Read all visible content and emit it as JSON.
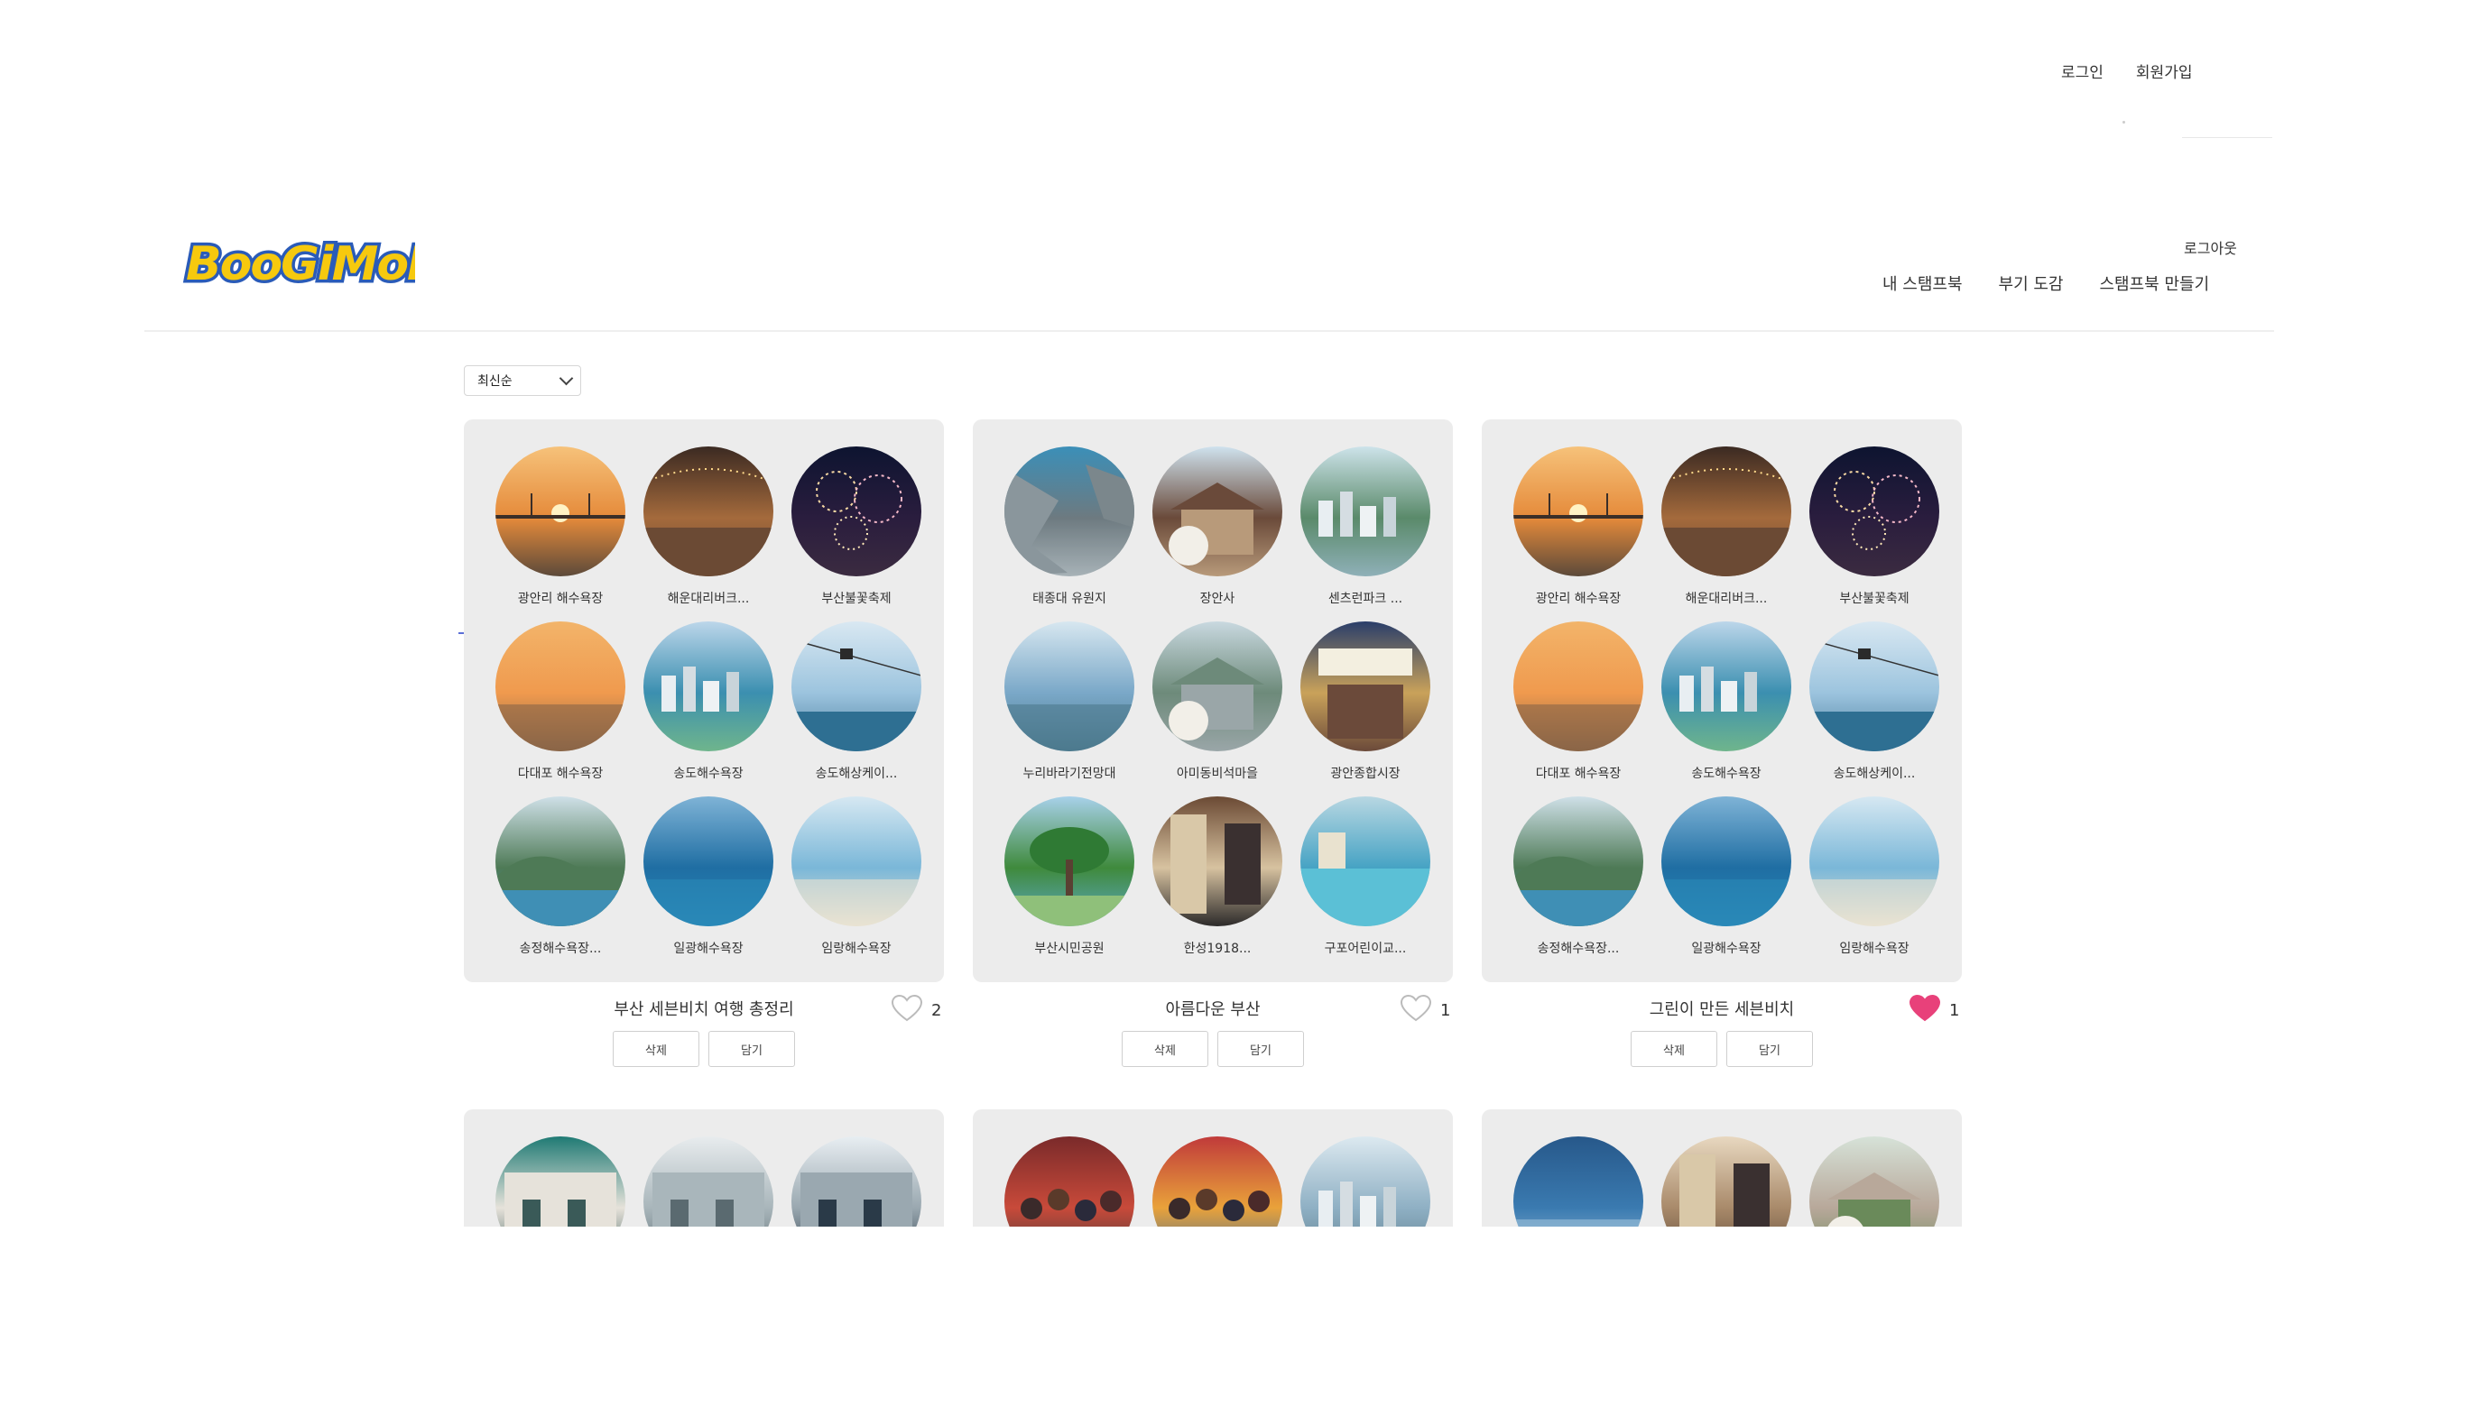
{
  "top_links": {
    "login": "로그인",
    "signup": "회원가입"
  },
  "header": {
    "logo_text": "BooGiMoN",
    "logout": "로그아웃",
    "nav": [
      "내 스탬프북",
      "부기 도감",
      "스탬프북 만들기"
    ]
  },
  "sort": {
    "selected": "최신순"
  },
  "colors": {
    "card_bg": "#ececec",
    "liked_heart": "#e8417a",
    "accent_line": "#5b6fd6"
  },
  "cards": [
    {
      "title": "부산 세븐비치 여행 총정리",
      "likes": "2",
      "liked": false,
      "delete_label": "삭제",
      "save_label": "담기",
      "items": [
        {
          "label": "광안리 해수욕장",
          "img": "sunset-bridge"
        },
        {
          "label": "해운대리버크...",
          "img": "evening-crowd"
        },
        {
          "label": "부산불꽃축제",
          "img": "fireworks"
        },
        {
          "label": "다대포 해수욕장",
          "img": "orange-sunset"
        },
        {
          "label": "송도해수욕장",
          "img": "bay-city"
        },
        {
          "label": "송도해상케이...",
          "img": "cable-car"
        },
        {
          "label": "송정해수욕장...",
          "img": "green-coast"
        },
        {
          "label": "일광해수욕장",
          "img": "blue-sea"
        },
        {
          "label": "임랑해수욕장",
          "img": "light-beach"
        }
      ]
    },
    {
      "title": "아름다운 부산",
      "likes": "1",
      "liked": false,
      "delete_label": "삭제",
      "save_label": "담기",
      "items": [
        {
          "label": "태종대 유원지",
          "img": "rocky-coast"
        },
        {
          "label": "장안사",
          "img": "temple"
        },
        {
          "label": "센츠런파크 ...",
          "img": "park-building"
        },
        {
          "label": "누리바라기전망대",
          "img": "observatory"
        },
        {
          "label": "아미동비석마을",
          "img": "village"
        },
        {
          "label": "광안종합시장",
          "img": "market"
        },
        {
          "label": "부산시민공원",
          "img": "tree-park"
        },
        {
          "label": "한성1918...",
          "img": "cafe-interior"
        },
        {
          "label": "구포어린이교...",
          "img": "water-park"
        }
      ]
    },
    {
      "title": "그린이 만든 세븐비치",
      "likes": "1",
      "liked": true,
      "delete_label": "삭제",
      "save_label": "담기",
      "items": [
        {
          "label": "광안리 해수욕장",
          "img": "sunset-bridge"
        },
        {
          "label": "해운대리버크...",
          "img": "evening-crowd"
        },
        {
          "label": "부산불꽃축제",
          "img": "fireworks"
        },
        {
          "label": "다대포 해수욕장",
          "img": "orange-sunset"
        },
        {
          "label": "송도해수욕장",
          "img": "bay-city"
        },
        {
          "label": "송도해상케이...",
          "img": "cable-car"
        },
        {
          "label": "송정해수욕장...",
          "img": "green-coast"
        },
        {
          "label": "일광해수욕장",
          "img": "blue-sea"
        },
        {
          "label": "임랑해수욕장",
          "img": "light-beach"
        }
      ]
    }
  ],
  "cards_partial": [
    {
      "items": [
        {
          "img": "teal-building"
        },
        {
          "img": "white-building"
        },
        {
          "img": "tent"
        }
      ]
    },
    {
      "items": [
        {
          "img": "festival-crowd"
        },
        {
          "img": "street-market"
        },
        {
          "img": "harbor-tower"
        }
      ]
    },
    {
      "items": [
        {
          "img": "island-sea"
        },
        {
          "img": "museum-interior"
        },
        {
          "img": "arch-building"
        }
      ]
    }
  ]
}
